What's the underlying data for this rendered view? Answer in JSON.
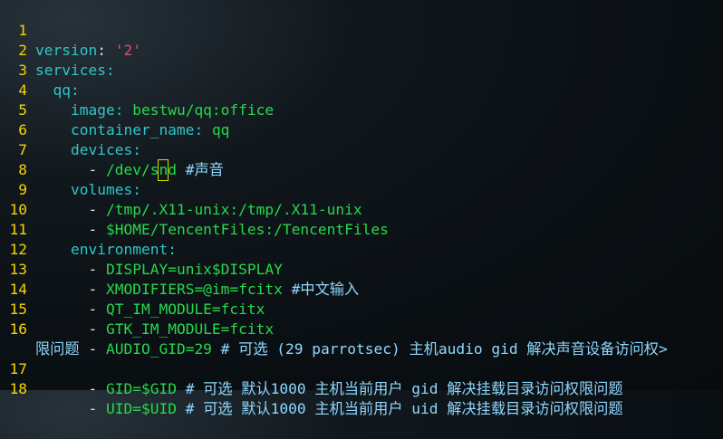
{
  "editor": {
    "lines": [
      {
        "num": "1",
        "indent": "",
        "key": "version",
        "colon": ": ",
        "value": "'2'"
      },
      {
        "num": "2",
        "indent": "",
        "key": "services",
        "colon": ":",
        "value": ""
      },
      {
        "num": "3",
        "indent": "  ",
        "key": "qq",
        "colon": ":",
        "value": ""
      },
      {
        "num": "4",
        "indent": "    ",
        "key": "image",
        "colon": ": ",
        "value": "bestwu/qq:office"
      },
      {
        "num": "5",
        "indent": "    ",
        "key": "container_name",
        "colon": ": ",
        "value": "qq"
      },
      {
        "num": "6",
        "indent": "    ",
        "key": "devices",
        "colon": ":",
        "value": ""
      },
      {
        "num": "7",
        "indent": "      ",
        "dash": "- ",
        "value_before_cursor": "/dev/s",
        "cursor_char": "n",
        "value_after_cursor": "d",
        "comment": " #声音"
      },
      {
        "num": "8",
        "indent": "    ",
        "key": "volumes",
        "colon": ":",
        "value": ""
      },
      {
        "num": "9",
        "indent": "      ",
        "dash": "- ",
        "value": "/tmp/.X11-unix:/tmp/.X11-unix"
      },
      {
        "num": "10",
        "indent": "      ",
        "dash": "- ",
        "value": "$HOME/TencentFiles:/TencentFiles"
      },
      {
        "num": "11",
        "indent": "    ",
        "key": "environment",
        "colon": ":",
        "value": ""
      },
      {
        "num": "12",
        "indent": "      ",
        "dash": "- ",
        "value": "DISPLAY=unix$DISPLAY"
      },
      {
        "num": "13",
        "indent": "      ",
        "dash": "- ",
        "value": "XMODIFIERS=@im=fcitx",
        "comment": " #中文输入"
      },
      {
        "num": "14",
        "indent": "      ",
        "dash": "- ",
        "value": "QT_IM_MODULE=fcitx"
      },
      {
        "num": "15",
        "indent": "      ",
        "dash": "- ",
        "value": "GTK_IM_MODULE=fcitx"
      },
      {
        "num": "16",
        "indent": "      ",
        "dash": "- ",
        "value": "AUDIO_GID=29",
        "comment": " # 可选 (29 parrotsec) 主机audio gid 解决声音设备访问权>",
        "wrap": "限问题"
      },
      {
        "num": "17",
        "indent": "      ",
        "dash": "- ",
        "value": "GID=$GID",
        "comment": " # 可选 默认1000 主机当前用户 gid 解决挂载目录访问权限问题"
      },
      {
        "num": "18",
        "indent": "      ",
        "dash": "- ",
        "value": "UID=$UID",
        "comment": " # 可选 默认1000 主机当前用户 uid 解决挂载目录访问权限问题"
      }
    ]
  },
  "colors": {
    "line_number": "#f5d400",
    "key": "#2ec6c6",
    "value": "#27d84a",
    "string": "#e0506a",
    "comment": "#8fd8ff"
  }
}
